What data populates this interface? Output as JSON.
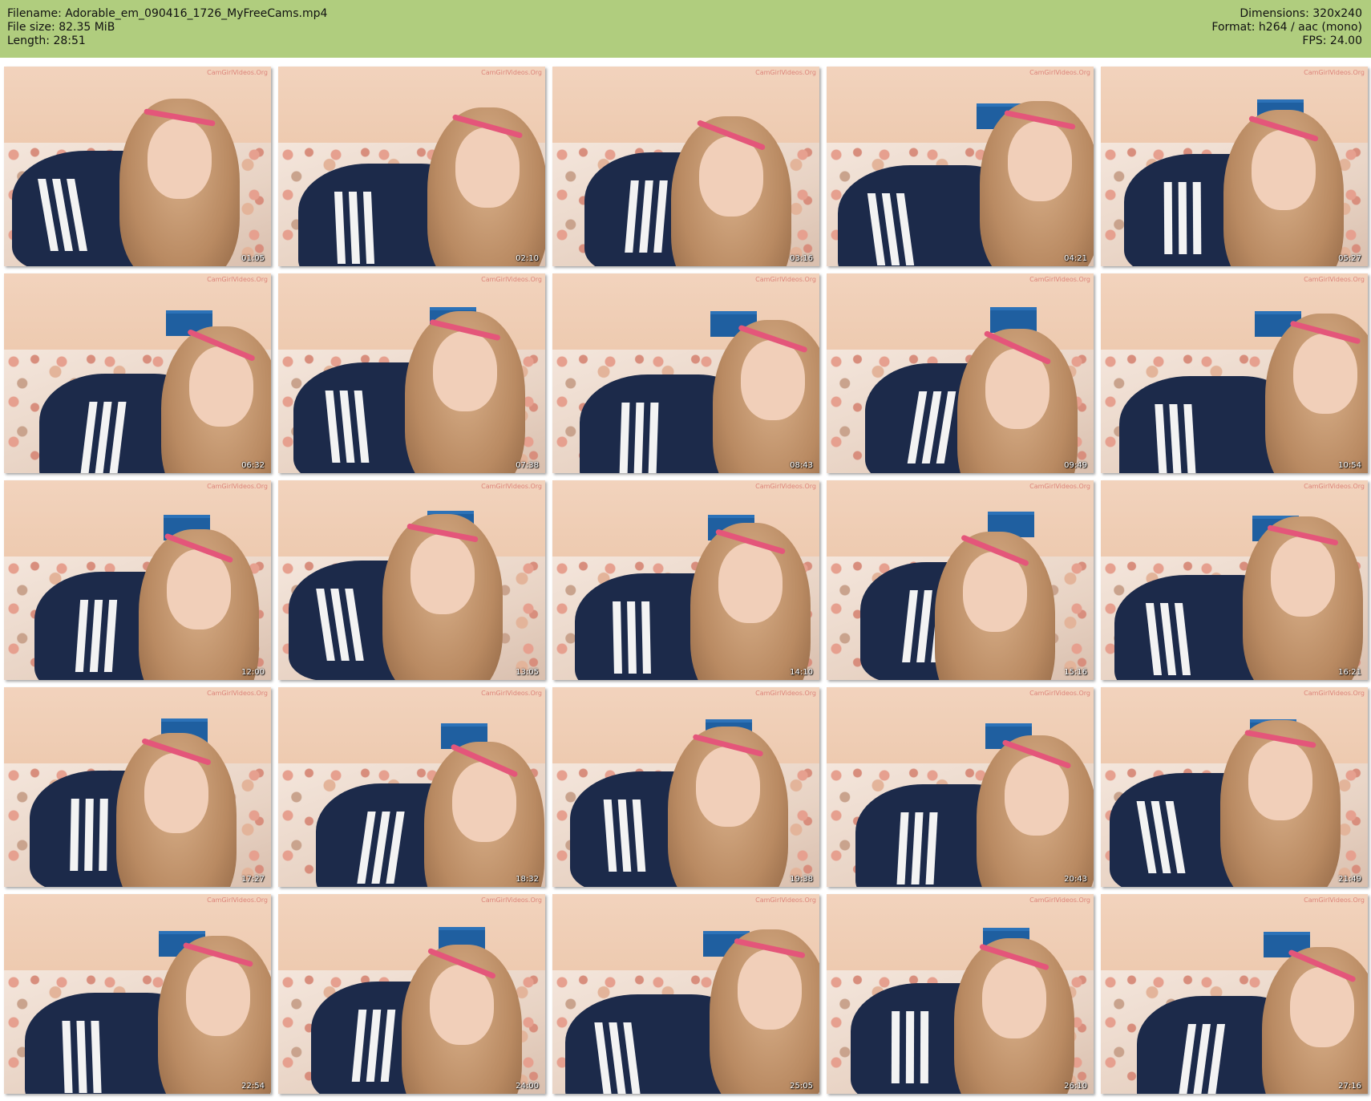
{
  "header": {
    "filename": "Filename: Adorable_em_090416_1726_MyFreeCams.mp4",
    "filesize": "File size: 82.35 MiB",
    "length": "Length: 28:51",
    "dimensions": "Dimensions: 320x240",
    "format": "Format: h264 / aac (mono)",
    "fps": "FPS: 24.00"
  },
  "watermark": "CamGirlVideos.Org",
  "thumbnails": [
    "01:05",
    "02:10",
    "03:16",
    "04:21",
    "05:27",
    "06:32",
    "07:38",
    "08:43",
    "09:49",
    "10:54",
    "12:00",
    "13:05",
    "14:10",
    "15:16",
    "16:21",
    "17:27",
    "18:32",
    "19:38",
    "20:43",
    "21:49",
    "22:54",
    "24:00",
    "25:05",
    "26:10",
    "27:16"
  ],
  "colors": {
    "header_bg": "#b0cd7e",
    "page_bg": "#ffffff"
  }
}
